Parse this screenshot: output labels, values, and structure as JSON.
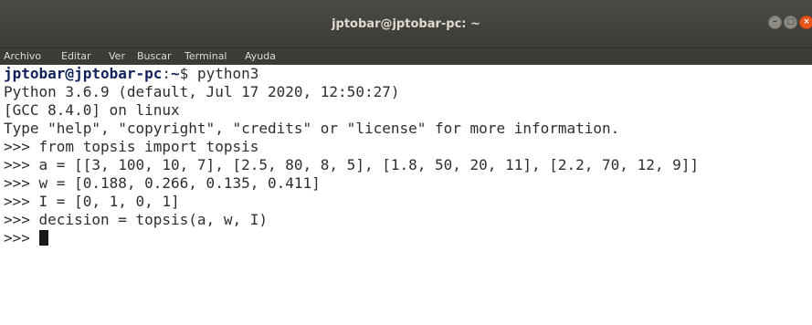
{
  "window": {
    "title": "jptobar@jptobar-pc: ~",
    "controls": {
      "minimize_icon": "–",
      "maximize_icon": "□",
      "close_icon": "×"
    },
    "colors": {
      "titlebar": "#3c3b37",
      "close_button": "#e9541b",
      "prompt_user": "#11225a",
      "terminal_background": "#ffffff"
    }
  },
  "menu": {
    "items": [
      "Archivo",
      "Editar",
      "Ver",
      "Buscar",
      "Terminal",
      "Ayuda"
    ]
  },
  "terminal": {
    "prompt_user_host": "jptobar@jptobar-pc",
    "prompt_sep": ":",
    "prompt_path": "~",
    "prompt_dollar": "$ ",
    "command": "python3",
    "lines": [
      "Python 3.6.9 (default, Jul 17 2020, 12:50:27)",
      "[GCC 8.4.0] on linux",
      "Type \"help\", \"copyright\", \"credits\" or \"license\" for more information.",
      ">>> from topsis import topsis",
      ">>> a = [[3, 100, 10, 7], [2.5, 80, 8, 5], [1.8, 50, 20, 11], [2.2, 70, 12, 9]]",
      ">>> w = [0.188, 0.266, 0.135, 0.411]",
      ">>> I = [0, 1, 0, 1]",
      ">>> decision = topsis(a, w, I)"
    ],
    "current_prompt": ">>> "
  }
}
